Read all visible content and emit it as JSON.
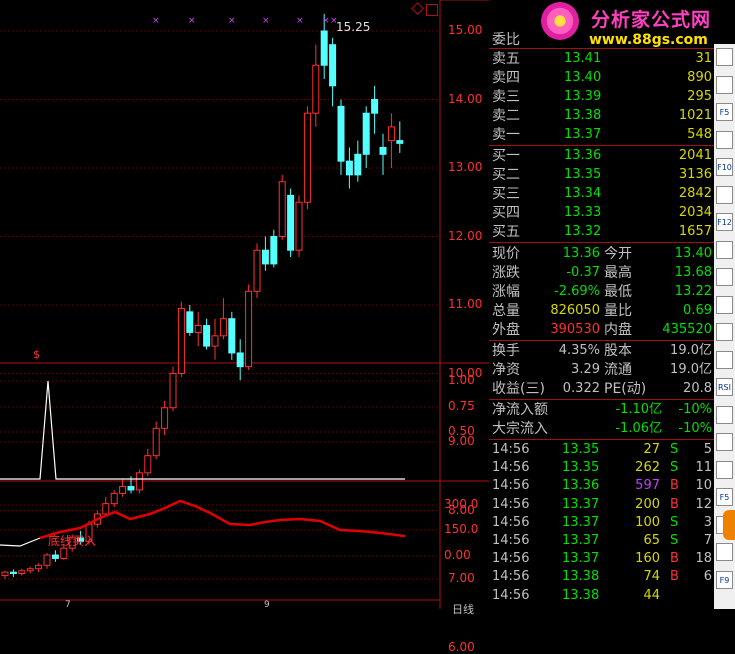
{
  "chart": {
    "price_ticks": [
      "15.00",
      "14.00",
      "13.00",
      "12.00",
      "11.00",
      "10.00",
      "9.00",
      "8.00",
      "7.00",
      "6.00"
    ],
    "high_label": "15.25",
    "ind_ticks": [
      "1.00",
      "0.75",
      "0.50"
    ],
    "macd_ticks": [
      "300.0",
      "150.0",
      "0.00"
    ],
    "signal_label": "底线买入",
    "dollar_mark": "$",
    "bottom_label": "日线",
    "axis_marks": [
      "7",
      "9"
    ]
  },
  "logo": {
    "title": "分析家公式网",
    "url": "www.88gs.com"
  },
  "quote": {
    "weibi_label": "委比",
    "asks": [
      {
        "label": "卖五",
        "price": "13.41",
        "vol": "31"
      },
      {
        "label": "卖四",
        "price": "13.40",
        "vol": "890"
      },
      {
        "label": "卖三",
        "price": "13.39",
        "vol": "295"
      },
      {
        "label": "卖二",
        "price": "13.38",
        "vol": "1021"
      },
      {
        "label": "卖一",
        "price": "13.37",
        "vol": "548"
      }
    ],
    "bids": [
      {
        "label": "买一",
        "price": "13.36",
        "vol": "2041"
      },
      {
        "label": "买二",
        "price": "13.35",
        "vol": "3136"
      },
      {
        "label": "买三",
        "price": "13.34",
        "vol": "2842"
      },
      {
        "label": "买四",
        "price": "13.33",
        "vol": "2034"
      },
      {
        "label": "买五",
        "price": "13.32",
        "vol": "1657"
      }
    ],
    "stats": [
      {
        "l1": "现价",
        "v1": "13.36",
        "l2": "今开",
        "v2": "13.40",
        "c1": "#00e000",
        "c2": "#00e000"
      },
      {
        "l1": "涨跌",
        "v1": "-0.37",
        "l2": "最高",
        "v2": "13.68",
        "c1": "#00e000",
        "c2": "#00e000"
      },
      {
        "l1": "涨幅",
        "v1": "-2.69%",
        "l2": "最低",
        "v2": "13.22",
        "c1": "#00e000",
        "c2": "#00e000"
      },
      {
        "l1": "总量",
        "v1": "826050",
        "l2": "量比",
        "v2": "0.69",
        "c1": "#d8d800",
        "c2": "#00e000"
      },
      {
        "l1": "外盘",
        "v1": "390530",
        "l2": "内盘",
        "v2": "435520",
        "c1": "#ff3030",
        "c2": "#00e000"
      }
    ],
    "stats2": [
      {
        "l1": "换手",
        "v1": "4.35%",
        "l2": "股本",
        "v2": "19.0亿"
      },
      {
        "l1": "净资",
        "v1": "3.29",
        "l2": "流通",
        "v2": "19.0亿"
      },
      {
        "l1": "收益(三)",
        "v1": "0.322",
        "l2": "PE(动)",
        "v2": "20.8"
      }
    ],
    "flows": [
      {
        "label": "净流入额",
        "value": "-1.10亿",
        "pct": "-10%"
      },
      {
        "label": "大宗流入",
        "value": "-1.06亿",
        "pct": "-10%"
      }
    ],
    "ticks": [
      {
        "time": "14:56",
        "price": "13.35",
        "vol": "27",
        "side": "S",
        "n": "5",
        "vc": "#d8d800"
      },
      {
        "time": "14:56",
        "price": "13.35",
        "vol": "262",
        "side": "S",
        "n": "11",
        "vc": "#d8d800"
      },
      {
        "time": "14:56",
        "price": "13.36",
        "vol": "597",
        "side": "B",
        "n": "10",
        "vc": "#c040ff"
      },
      {
        "time": "14:56",
        "price": "13.37",
        "vol": "200",
        "side": "B",
        "n": "12",
        "vc": "#d8d800"
      },
      {
        "time": "14:56",
        "price": "13.37",
        "vol": "100",
        "side": "S",
        "n": "3",
        "vc": "#d8d800"
      },
      {
        "time": "14:56",
        "price": "13.37",
        "vol": "65",
        "side": "S",
        "n": "7",
        "vc": "#d8d800"
      },
      {
        "time": "14:56",
        "price": "13.37",
        "vol": "160",
        "side": "B",
        "n": "18",
        "vc": "#d8d800"
      },
      {
        "time": "14:56",
        "price": "13.38",
        "vol": "74",
        "side": "B",
        "n": "6",
        "vc": "#d8d800"
      },
      {
        "time": "14:56",
        "price": "13.38",
        "vol": "44",
        "side": "",
        "n": "",
        "vc": "#d8d800"
      }
    ]
  },
  "toolbar": [
    "",
    "",
    "F5",
    "",
    "F10",
    "",
    "F12",
    "",
    "",
    "",
    "",
    "",
    "RSI",
    "",
    "",
    "",
    "F5",
    "",
    "",
    "F9"
  ]
}
